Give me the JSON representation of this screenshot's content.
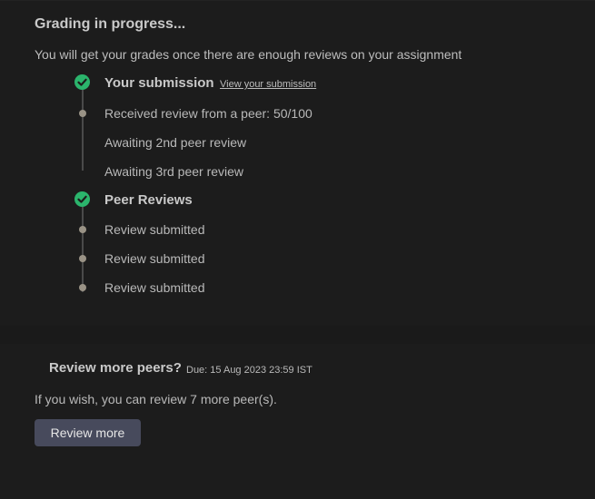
{
  "grading": {
    "title": "Grading in progress...",
    "subtitle": "You will get your grades once there are enough reviews on your assignment"
  },
  "submission": {
    "title": "Your submission",
    "view_link": "View your submission",
    "steps": [
      "Received review from a peer: 50/100",
      "Awaiting 2nd peer review",
      "Awaiting 3rd peer review"
    ]
  },
  "peer_reviews": {
    "title": "Peer Reviews",
    "steps": [
      "Review submitted",
      "Review submitted",
      "Review submitted"
    ]
  },
  "review_more": {
    "title": "Review more peers?",
    "due": "Due: 15 Aug 2023 23:59 IST",
    "description": "If you wish, you can review 7 more peer(s).",
    "button_label": "Review more"
  },
  "colors": {
    "check_green": "#2bb46c",
    "button_bg": "#474a5c",
    "dot": "#9a9386"
  },
  "icons": {
    "section_status": "check-circle-icon",
    "step_status": "dot-icon"
  }
}
